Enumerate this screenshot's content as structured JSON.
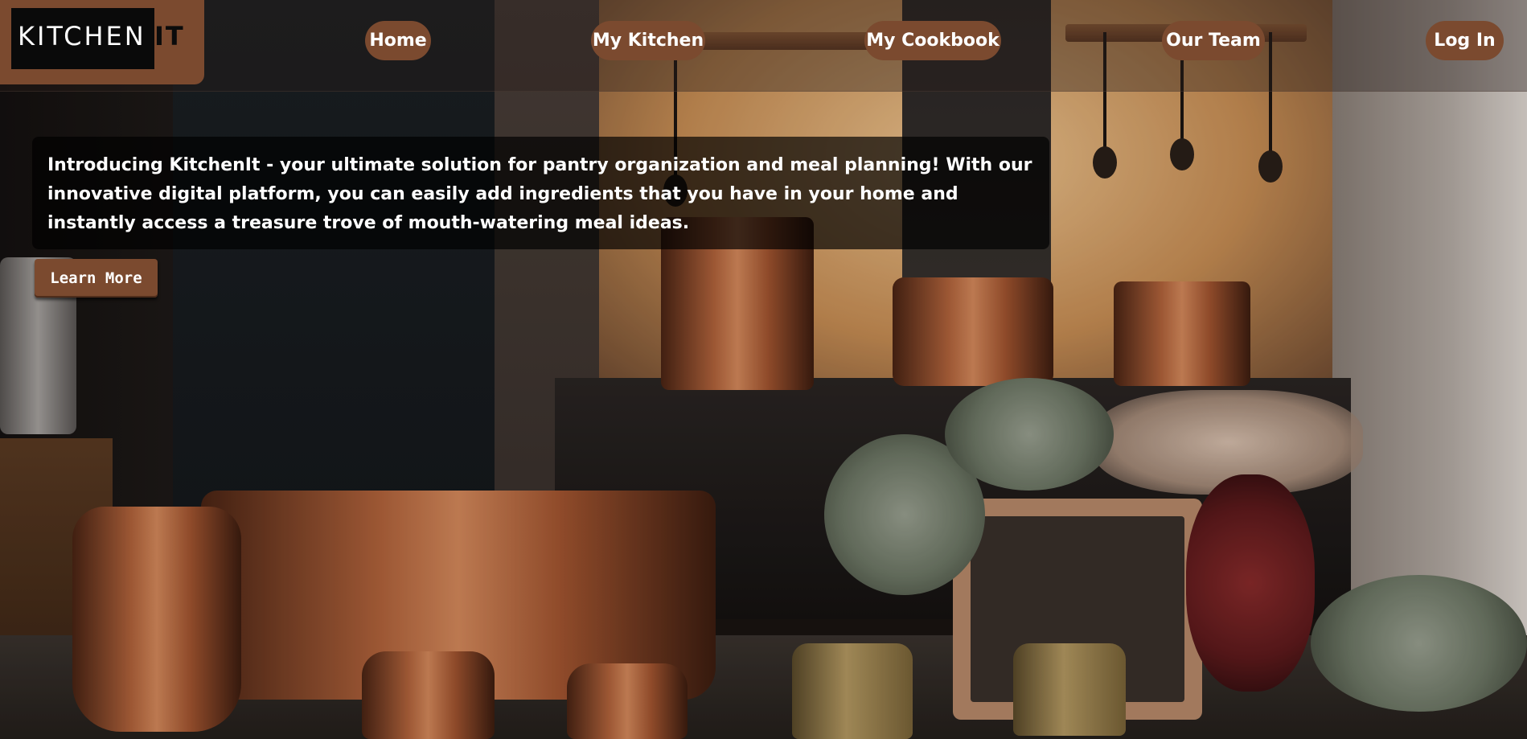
{
  "brand": {
    "logo_text": "KITCHEN",
    "logo_accent": "IT",
    "accent_color": "#7b4a2f"
  },
  "nav": {
    "home": "Home",
    "my_kitchen": "My Kitchen",
    "my_cookbook": "My Cookbook",
    "our_team": "Our Team",
    "log_in": "Log In"
  },
  "hero": {
    "intro_text": "Introducing KitchenIt - your ultimate solution for pantry organization and meal planning! With our innovative digital platform, you can easily add ingredients that you have in your home and instantly access a treasure trove of mouth-watering meal ideas.",
    "cta_label": "Learn More"
  }
}
